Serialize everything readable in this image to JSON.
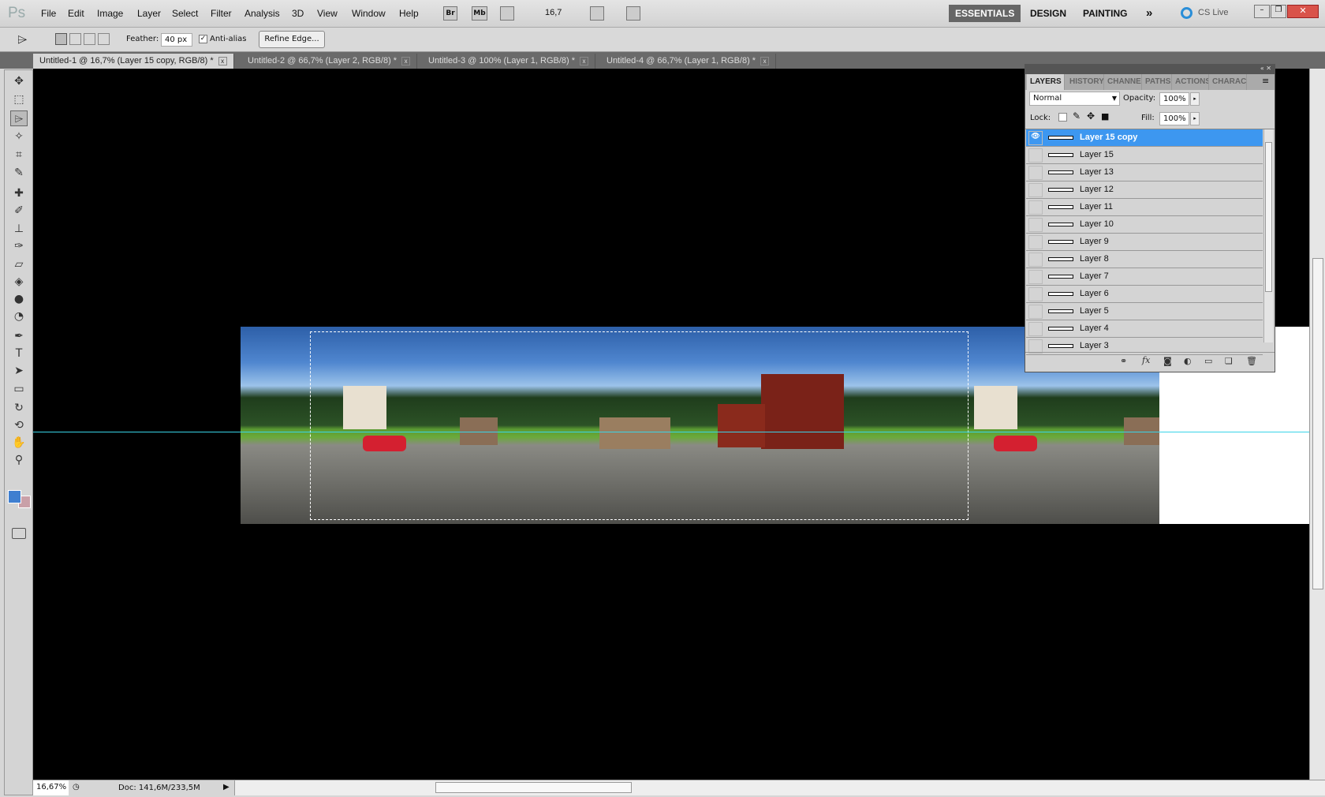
{
  "app": {
    "logo": "Ps"
  },
  "menu": [
    "File",
    "Edit",
    "Image",
    "Layer",
    "Select",
    "Filter",
    "Analysis",
    "3D",
    "View",
    "Window",
    "Help"
  ],
  "appbar": {
    "bridge": "Br",
    "minibridge": "Mb",
    "zoom": "16,7"
  },
  "workspaces": [
    "ESSENTIALS",
    "DESIGN",
    "PAINTING"
  ],
  "more": "»",
  "cslive": "CS Live",
  "options": {
    "feather_label": "Feather:",
    "feather_value": "40 px",
    "antialias_label": "Anti-alias",
    "antialias_checked": true,
    "refine_edge": "Refine Edge..."
  },
  "tabs": [
    {
      "label": "Untitled-1 @ 16,7% (Layer 15 copy, RGB/8) *",
      "active": true
    },
    {
      "label": "Untitled-2 @ 66,7% (Layer 2, RGB/8) *"
    },
    {
      "label": "Untitled-3 @ 100% (Layer 1, RGB/8) *"
    },
    {
      "label": "Untitled-4 @ 66,7% (Layer 1, RGB/8) *"
    }
  ],
  "layers_panel": {
    "tabs": [
      "LAYERS",
      "HISTORY",
      "CHANNELS",
      "PATHS",
      "ACTIONS",
      "CHARACTER"
    ],
    "blend_mode": "Normal",
    "opacity_label": "Opacity:",
    "opacity": "100%",
    "lock_label": "Lock:",
    "fill_label": "Fill:",
    "fill": "100%",
    "layers": [
      "Layer 15 copy",
      "Layer 15",
      "Layer 13",
      "Layer 12",
      "Layer 11",
      "Layer 10",
      "Layer 9",
      "Layer 8",
      "Layer 7",
      "Layer 6",
      "Layer 5",
      "Layer 4",
      "Layer 3"
    ]
  },
  "status": {
    "zoom": "16,67%",
    "doc": "Doc: 141,6M/233,5M"
  },
  "colors": {
    "foreground": "#3f7fd0",
    "background": "#c9a0a8",
    "guide": "#39d4e8",
    "selected_layer": "#3d97f0"
  }
}
